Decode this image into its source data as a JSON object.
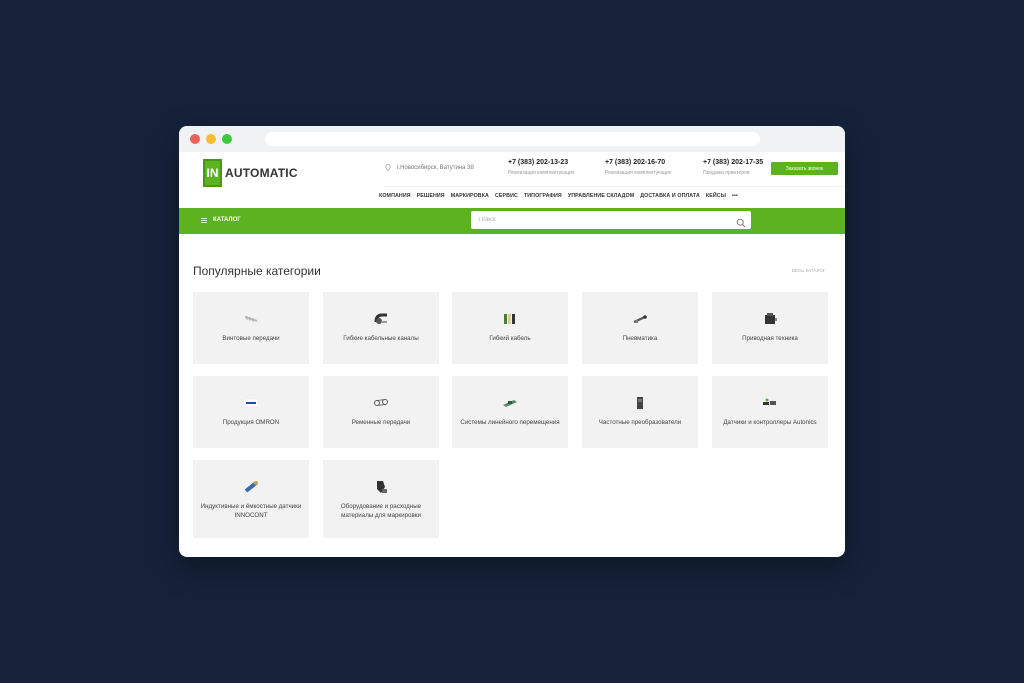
{
  "header": {
    "logo_badge": "IN",
    "logo_text": "AUTOMATIC",
    "address": "г.Новосибирск, Ватутина 38",
    "phones": [
      {
        "number": "+7 (383) 202-13-23",
        "caption": "Реализация комплектующих"
      },
      {
        "number": "+7 (383) 202-16-70",
        "caption": "Реализация комплектующих"
      },
      {
        "number": "+7 (383) 202-17-35",
        "caption": "Продажа принтеров"
      }
    ],
    "order_button": "Заказать звонок"
  },
  "nav": {
    "items": [
      "КОМПАНИЯ",
      "РЕШЕНИЯ",
      "МАРКИРОВКА",
      "СЕРВИС",
      "ТИПОГРАФИЯ",
      "УПРАВЛЕНИЕ СКЛАДОМ",
      "ДОСТАВКА И ОПЛАТА",
      "КЕЙСЫ",
      "•••"
    ]
  },
  "catalog_bar": {
    "catalog_label": "КАТАЛОГ",
    "search_placeholder": "Поиск"
  },
  "main": {
    "title": "Популярные категории",
    "all_link": "ВЕСЬ КАТАЛОГ",
    "categories": [
      {
        "label": "Винтовые передачи",
        "icon": "screw-icon"
      },
      {
        "label": "Гибкие кабельные каналы",
        "icon": "cable-chain-icon"
      },
      {
        "label": "Гибкий кабель",
        "icon": "cable-icon"
      },
      {
        "label": "Пневматика",
        "icon": "pneumatic-icon"
      },
      {
        "label": "Приводная техника",
        "icon": "motor-icon"
      },
      {
        "label": "Продукция OMRON",
        "icon": "omron-icon"
      },
      {
        "label": "Ременные передачи",
        "icon": "belt-icon"
      },
      {
        "label": "Системы линейного перемещения",
        "icon": "linear-icon"
      },
      {
        "label": "Частотные преобразователи",
        "icon": "inverter-icon"
      },
      {
        "label": "Датчики и контроллеры Autonics",
        "icon": "sensor-icon"
      },
      {
        "label": "Индуктивные и ёмкостные датчики INNOCONT",
        "icon": "inductive-sensor-icon"
      },
      {
        "label": "Оборудование и расходные материалы для маркировки",
        "icon": "marking-icon"
      }
    ]
  },
  "colors": {
    "accent": "#5db21f",
    "background": "#15223a",
    "card": "#f2f2f2"
  }
}
